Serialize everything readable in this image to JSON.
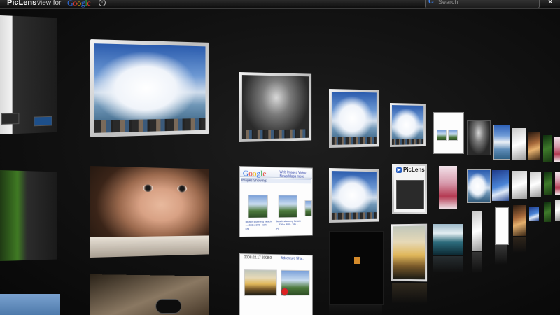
{
  "app": {
    "name": "PicLens",
    "trademark": "™",
    "view_for_text": "view for",
    "provider": "Google",
    "provider_letters": [
      "G",
      "o",
      "o",
      "g",
      "l",
      "e"
    ]
  },
  "search": {
    "placeholder": "Search",
    "value": "",
    "provider_icon": "G"
  },
  "toolbar": {
    "info_icon_glyph": "i",
    "close_glyph": "×"
  },
  "tiles": {
    "google_images_page": {
      "logo": "Google",
      "subtitle": "Images",
      "tabs": "Web  Images  Video  News  Maps  more",
      "result_bar": "Images   Showing: ",
      "captions": [
        "Beach stunning beach ... 436 x 300 - 18k - jpg",
        "Beach stunning beach ... 436 x 300 - 18k - jpg",
        "www.google.com"
      ]
    },
    "piclens_panel": {
      "label": "PicLens"
    },
    "news_page": {
      "header_left": "2008.02.17  2008.0",
      "header_right": "Adventure Sha..."
    },
    "small_piclens": {
      "label": "PicLens"
    }
  },
  "colors": {
    "accent_blue": "#2f6fe4",
    "background": "#121212",
    "topbar": "#1a1a1a"
  }
}
